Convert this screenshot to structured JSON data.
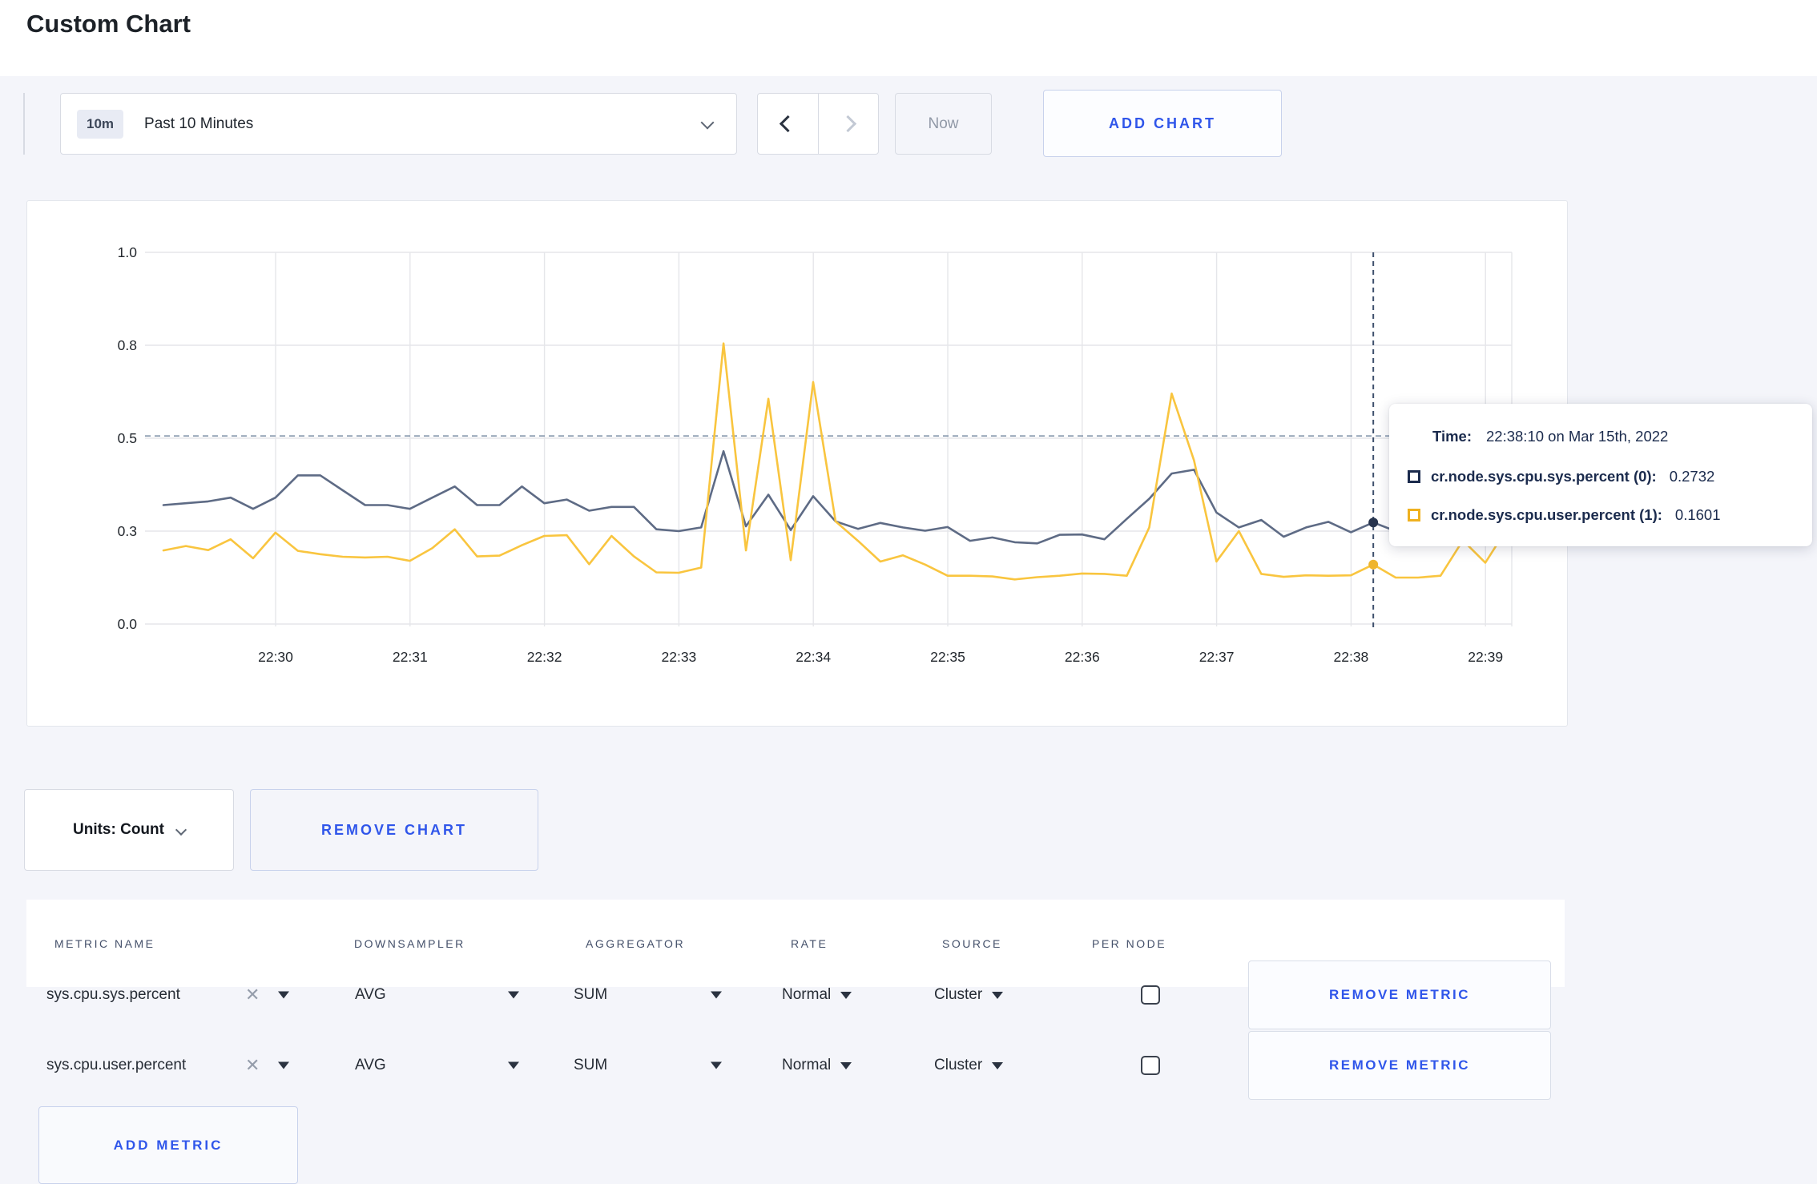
{
  "page": {
    "title": "Custom Chart"
  },
  "toolbar": {
    "time_range_badge": "10m",
    "time_range_label": "Past 10 Minutes",
    "now_label": "Now",
    "add_chart_label": "ADD CHART"
  },
  "chart_controls": {
    "units_label": "Units: Count",
    "remove_chart_label": "REMOVE CHART"
  },
  "tooltip": {
    "time_label": "Time:",
    "time_value": "22:38:10 on Mar 15th, 2022",
    "series": [
      {
        "name": "cr.node.sys.cpu.sys.percent (0):",
        "value": "0.2732",
        "color": "#1b2b4d"
      },
      {
        "name": "cr.node.sys.cpu.user.percent (1):",
        "value": "0.1601",
        "color": "#efb11f"
      }
    ]
  },
  "chart_data": {
    "type": "line",
    "title": "",
    "xlabel": "",
    "ylabel": "",
    "ylim": [
      0,
      1
    ],
    "grid": true,
    "legend_position": "none",
    "x_start_time": "22:29:10",
    "x_interval_seconds": 10,
    "x_ticks": [
      "22:30",
      "22:31",
      "22:32",
      "22:33",
      "22:34",
      "22:35",
      "22:36",
      "22:37",
      "22:38",
      "22:39"
    ],
    "y_ticks": [
      {
        "value": 0,
        "label": "0.0"
      },
      {
        "value": 0.25,
        "label": "0.3"
      },
      {
        "value": 0.5,
        "label": "0.5"
      },
      {
        "value": 0.75,
        "label": "0.8"
      },
      {
        "value": 1,
        "label": "1.0"
      }
    ],
    "guideline_value": 0.506,
    "crosshair": {
      "index": 54,
      "time": "22:38:10"
    },
    "series": [
      {
        "name": "cr.node.sys.cpu.sys.percent",
        "color": "#5e6b85",
        "dot_color": "#27344e",
        "values": [
          0.32,
          0.325,
          0.33,
          0.34,
          0.31,
          0.34,
          0.4,
          0.4,
          0.36,
          0.32,
          0.32,
          0.31,
          0.34,
          0.37,
          0.32,
          0.32,
          0.37,
          0.325,
          0.335,
          0.305,
          0.315,
          0.315,
          0.255,
          0.25,
          0.26,
          0.465,
          0.263,
          0.348,
          0.253,
          0.344,
          0.276,
          0.256,
          0.272,
          0.26,
          0.251,
          0.261,
          0.224,
          0.233,
          0.22,
          0.217,
          0.24,
          0.241,
          0.228,
          0.283,
          0.337,
          0.405,
          0.415,
          0.3,
          0.26,
          0.28,
          0.235,
          0.26,
          0.275,
          0.247,
          0.2732,
          0.25,
          0.26,
          0.27,
          0.285,
          0.3,
          0.305
        ]
      },
      {
        "name": "cr.node.sys.cpu.user.percent",
        "color": "#f9c53f",
        "dot_color": "#efb52c",
        "values": [
          0.198,
          0.21,
          0.199,
          0.228,
          0.177,
          0.246,
          0.197,
          0.188,
          0.181,
          0.179,
          0.181,
          0.17,
          0.204,
          0.255,
          0.182,
          0.184,
          0.212,
          0.237,
          0.239,
          0.161,
          0.237,
          0.182,
          0.139,
          0.138,
          0.152,
          0.755,
          0.198,
          0.606,
          0.172,
          0.651,
          0.276,
          0.224,
          0.168,
          0.185,
          0.16,
          0.13,
          0.13,
          0.128,
          0.12,
          0.126,
          0.13,
          0.136,
          0.135,
          0.13,
          0.26,
          0.62,
          0.44,
          0.168,
          0.25,
          0.135,
          0.127,
          0.131,
          0.13,
          0.131,
          0.1601,
          0.125,
          0.125,
          0.13,
          0.225,
          0.165,
          0.26
        ]
      }
    ]
  },
  "metrics_table": {
    "headers": [
      "METRIC NAME",
      "DOWNSAMPLER",
      "AGGREGATOR",
      "RATE",
      "SOURCE",
      "PER NODE"
    ],
    "rows": [
      {
        "metric": "sys.cpu.sys.percent",
        "downsampler": "AVG",
        "aggregator": "SUM",
        "rate": "Normal",
        "source": "Cluster",
        "per_node": false,
        "remove_label": "REMOVE METRIC"
      },
      {
        "metric": "sys.cpu.user.percent",
        "downsampler": "AVG",
        "aggregator": "SUM",
        "rate": "Normal",
        "source": "Cluster",
        "per_node": false,
        "remove_label": "REMOVE METRIC"
      }
    ],
    "add_metric_label": "ADD METRIC"
  },
  "icons": {
    "clear": "✕"
  }
}
